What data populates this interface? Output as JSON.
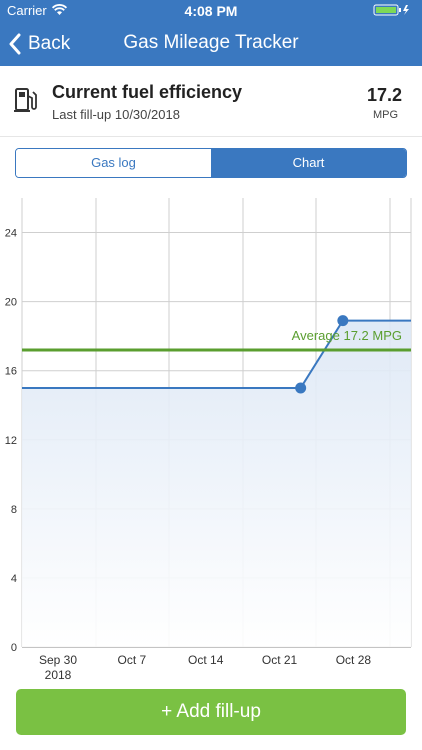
{
  "status_bar": {
    "carrier": "Carrier",
    "time": "4:08 PM"
  },
  "nav": {
    "back_label": "Back",
    "title": "Gas Mileage Tracker"
  },
  "summary": {
    "title": "Current fuel efficiency",
    "last_fillup": "Last fill-up 10/30/2018",
    "value": "17.2",
    "unit": "MPG"
  },
  "tabs": [
    {
      "label": "Gas log",
      "active": false
    },
    {
      "label": "Chart",
      "active": true
    }
  ],
  "colors": {
    "brand": "#3a78c0",
    "average": "#5a9e2f",
    "add_button": "#7ac143"
  },
  "chart_data": {
    "type": "line",
    "y_ticks": [
      0,
      4,
      8,
      12,
      16,
      20,
      24
    ],
    "ylim": [
      0,
      26
    ],
    "x_ticks": [
      "Sep 30\n2018",
      "Oct 7",
      "Oct 14",
      "Oct 21",
      "Oct 28"
    ],
    "series": [
      {
        "values": [
          15,
          15,
          15,
          15,
          15,
          15,
          19,
          19,
          19
        ]
      }
    ],
    "points": [
      {
        "x": "2018-10-23",
        "y": 15.0
      },
      {
        "x": "2018-10-27",
        "y": 18.9
      }
    ],
    "average": {
      "value": 17.2,
      "label": "Average 17.2 MPG"
    },
    "grid": true
  },
  "add_button": {
    "label": "+ Add fill-up"
  }
}
